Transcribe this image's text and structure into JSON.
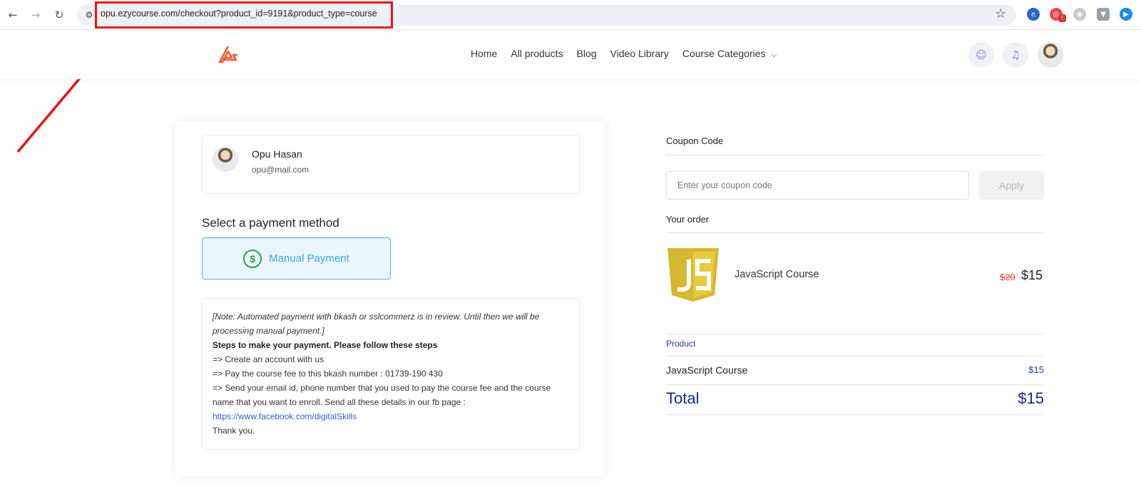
{
  "browser": {
    "url": "opu.ezycourse.com/checkout?product_id=9191&product_type=course",
    "back_icon": "arrow-left-icon",
    "forward_icon": "arrow-right-icon",
    "reload_icon": "reload-icon",
    "bookmark_icon": "star-icon",
    "ext_badge": "!"
  },
  "header": {
    "menu": [
      "Home",
      "All products",
      "Blog",
      "Video Library",
      "Course Categories"
    ],
    "icons": [
      "chat-icon",
      "bell-icon",
      "avatar"
    ]
  },
  "user": {
    "name": "Opu Hasan",
    "email": "opu@mail.com"
  },
  "payment": {
    "title": "Select a payment method",
    "method": "Manual Payment",
    "dollar_symbol": "$"
  },
  "note": {
    "italic": "[Note: Automated payment with bkash or sslcommerz is in review. Until then we will be processing manual payment.]",
    "steps_title": "Steps to make your payment. Please follow these steps",
    "step1": "=> Create an account with us",
    "step2": "=> Pay the course fee to this bkash number : 01739-190 430",
    "step3": "=> Send your email id, phone number that you used to pay the course fee and the course name that you want to enroll. Send all these details in our fb page :",
    "link": "https://www.facebook.com/digitalSkills",
    "thanks": "Thank you."
  },
  "coupon": {
    "label": "Coupon Code",
    "placeholder": "Enter your coupon code",
    "apply": "Apply"
  },
  "order": {
    "title": "Your order",
    "course_name": "JavaScript Course",
    "old_price": "$20",
    "new_price": "$15",
    "product_label": "Product",
    "row_name": "JavaScript Course",
    "row_price": "$15",
    "total_label": "Total",
    "total_value": "$15"
  },
  "colors": {
    "accent_blue": "#3aa6df",
    "total_blue": "#1a2a8c",
    "highlight_red": "#ee1111",
    "js_yellow": "#d4b82f"
  }
}
